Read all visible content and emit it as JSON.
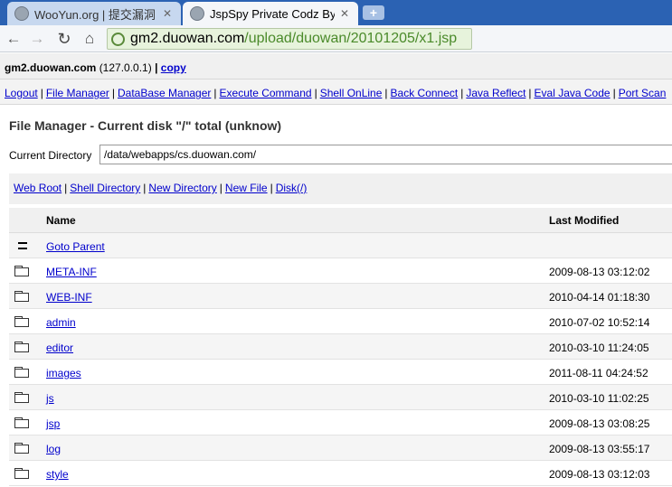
{
  "browser": {
    "tabs": [
      {
        "title": "WooYun.org | 提交漏洞",
        "active": false
      },
      {
        "title": "JspSpy Private Codz By -",
        "active": true
      }
    ],
    "address": {
      "host": "gm2.duowan.com",
      "path": "/upload/duowan/20101205/x1.jsp"
    }
  },
  "hostbar": {
    "hostname": "gm2.duowan.com",
    "ip": "(127.0.0.1)",
    "separator": "|",
    "copy_label": "copy"
  },
  "menu": [
    {
      "label": "Logout"
    },
    {
      "label": "File Manager"
    },
    {
      "label": "DataBase Manager"
    },
    {
      "label": "Execute Command"
    },
    {
      "label": "Shell OnLine"
    },
    {
      "label": "Back Connect"
    },
    {
      "label": "Java Reflect"
    },
    {
      "label": "Eval Java Code"
    },
    {
      "label": "Port Scan"
    }
  ],
  "file_manager": {
    "title": "File Manager - Current disk \"/\" total (unknow)",
    "current_directory_label": "Current Directory",
    "current_directory_value": "/data/webapps/cs.duowan.com/",
    "actions": [
      {
        "label": "Web Root"
      },
      {
        "label": "Shell Directory"
      },
      {
        "label": "New Directory"
      },
      {
        "label": "New File"
      },
      {
        "label": "Disk(/)"
      }
    ],
    "columns": {
      "name": "Name",
      "modified": "Last Modified"
    },
    "parent_label": "Goto Parent",
    "entries": [
      {
        "name": "META-INF",
        "modified": "2009-08-13 03:12:02"
      },
      {
        "name": "WEB-INF",
        "modified": "2010-04-14 01:18:30"
      },
      {
        "name": "admin",
        "modified": "2010-07-02 10:52:14"
      },
      {
        "name": "editor",
        "modified": "2010-03-10 11:24:05"
      },
      {
        "name": "images",
        "modified": "2011-08-11 04:24:52"
      },
      {
        "name": "js",
        "modified": "2010-03-10 11:02:25"
      },
      {
        "name": "jsp",
        "modified": "2009-08-13 03:08:25"
      },
      {
        "name": "log",
        "modified": "2009-08-13 03:55:17"
      },
      {
        "name": "style",
        "modified": "2009-08-13 03:12:03"
      }
    ]
  }
}
